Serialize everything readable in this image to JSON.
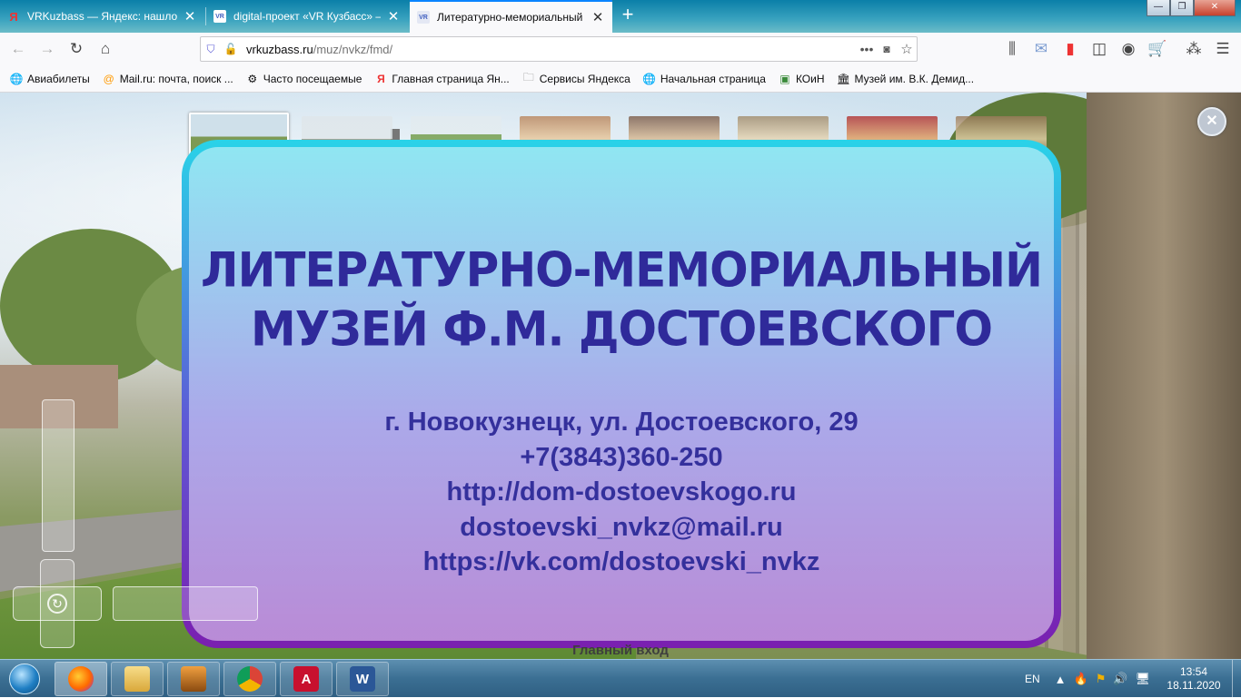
{
  "browser": {
    "tabs": [
      {
        "title": "VRKuzbass — Яндекс: нашлось",
        "favicon": "Я",
        "active": false
      },
      {
        "title": "digital-проект «VR Кузбасс» —",
        "favicon": "VR",
        "active": false
      },
      {
        "title": "Литературно-мемориальный",
        "favicon": "VR",
        "active": true
      }
    ],
    "new_tab_glyph": "+",
    "window_buttons": {
      "minimize": "—",
      "maximize": "❐",
      "close": "✕"
    },
    "url": {
      "domain": "vrkuzbass.ru",
      "path": "/muz/nvkz/fmd/"
    },
    "bookmarks": [
      {
        "label": "Авиабилеты",
        "icon": "globe-icon"
      },
      {
        "label": "Mail.ru: почта, поиск ...",
        "icon": "mailru-icon"
      },
      {
        "label": "Часто посещаемые",
        "icon": "gear-icon"
      },
      {
        "label": "Главная страница Ян...",
        "icon": "yandex-icon"
      },
      {
        "label": "Сервисы Яндекса",
        "icon": "folder-icon"
      },
      {
        "label": "Начальная страница",
        "icon": "globe-icon"
      },
      {
        "label": "КОиН",
        "icon": "koin-icon"
      },
      {
        "label": "Музей им. В.К. Демид...",
        "icon": "museum-icon"
      }
    ]
  },
  "panorama": {
    "info": {
      "title_line1": "ЛИТЕРАТУРНО-МЕМОРИАЛЬНЫЙ",
      "title_line2": "МУЗЕЙ Ф.М. ДОСТОЕВСКОГО",
      "address": "г. Новокузнецк, ул. Достоевского, 29",
      "phone": "+7(3843)360-250",
      "website": "http://dom-dostoevskogo.ru",
      "email": "dostoevski_nvkz@mail.ru",
      "vk": "https://vk.com/dostoevski_nvkz"
    },
    "close_glyph": "✕",
    "scene_label": "Главный вход",
    "thumbnails_count": 8,
    "selected_thumbnail": 1
  },
  "taskbar": {
    "apps": [
      "firefox",
      "explorer",
      "winamp",
      "chrome",
      "acrobat",
      "word"
    ],
    "language": "EN",
    "time": "13:54",
    "date": "18.11.2020"
  },
  "colors": {
    "title": "#2f2a9a",
    "frame_top": "#29d3e8",
    "frame_bottom": "#7a1fb0"
  }
}
